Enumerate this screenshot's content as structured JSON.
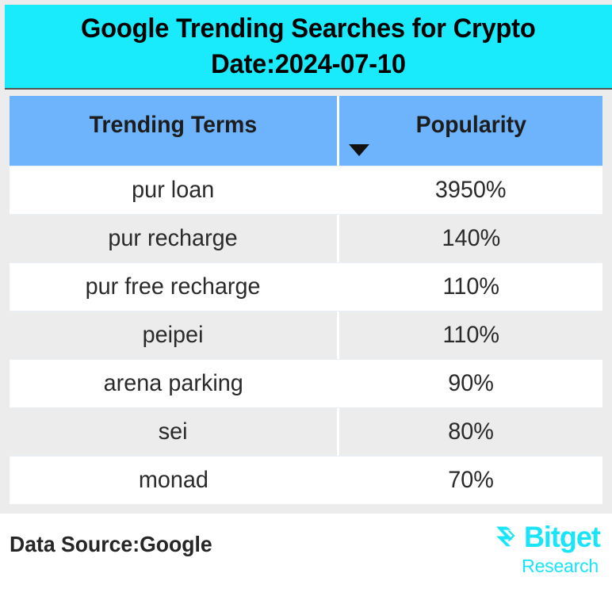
{
  "header": {
    "title_line_1": "Google Trending Searches for Crypto",
    "title_line_2": "Date:2024-07-10",
    "background_color": "#19ebfd",
    "text_color": "#000000"
  },
  "table": {
    "header_background": "#6db4fd",
    "alt_row_background": "#ececec",
    "columns": [
      {
        "label": "Trending Terms",
        "sorted": false
      },
      {
        "label": "Popularity",
        "sorted": true,
        "sort_direction": "desc",
        "sort_icon": "triangle-down-icon"
      }
    ],
    "rows": [
      {
        "term": "pur loan",
        "popularity": "3950%"
      },
      {
        "term": "pur recharge",
        "popularity": "140%"
      },
      {
        "term": "pur free recharge",
        "popularity": "110%"
      },
      {
        "term": "peipei",
        "popularity": "110%"
      },
      {
        "term": "arena parking",
        "popularity": "90%"
      },
      {
        "term": "sei",
        "popularity": "80%"
      },
      {
        "term": "monad",
        "popularity": "70%"
      }
    ]
  },
  "footer": {
    "data_source": "Data Source:Google",
    "brand_name": "Bitget",
    "brand_sub": "Research",
    "brand_color": "#1ae4f8",
    "brand_mark_icon": "bitget-arrow-logo-icon"
  },
  "chart_data": {
    "type": "table",
    "title": "Google Trending Searches for Crypto",
    "subtitle": "Date:2024-07-10",
    "columns": [
      "Trending Terms",
      "Popularity"
    ],
    "categories": [
      "pur loan",
      "pur recharge",
      "pur free recharge",
      "peipei",
      "arena parking",
      "sei",
      "monad"
    ],
    "values": [
      3950,
      140,
      110,
      110,
      90,
      80,
      70
    ],
    "value_unit": "%",
    "ylabel": "Popularity",
    "xlabel": "Trending Terms",
    "sorted_by": "Popularity",
    "sort_order": "descending",
    "source": "Google"
  }
}
